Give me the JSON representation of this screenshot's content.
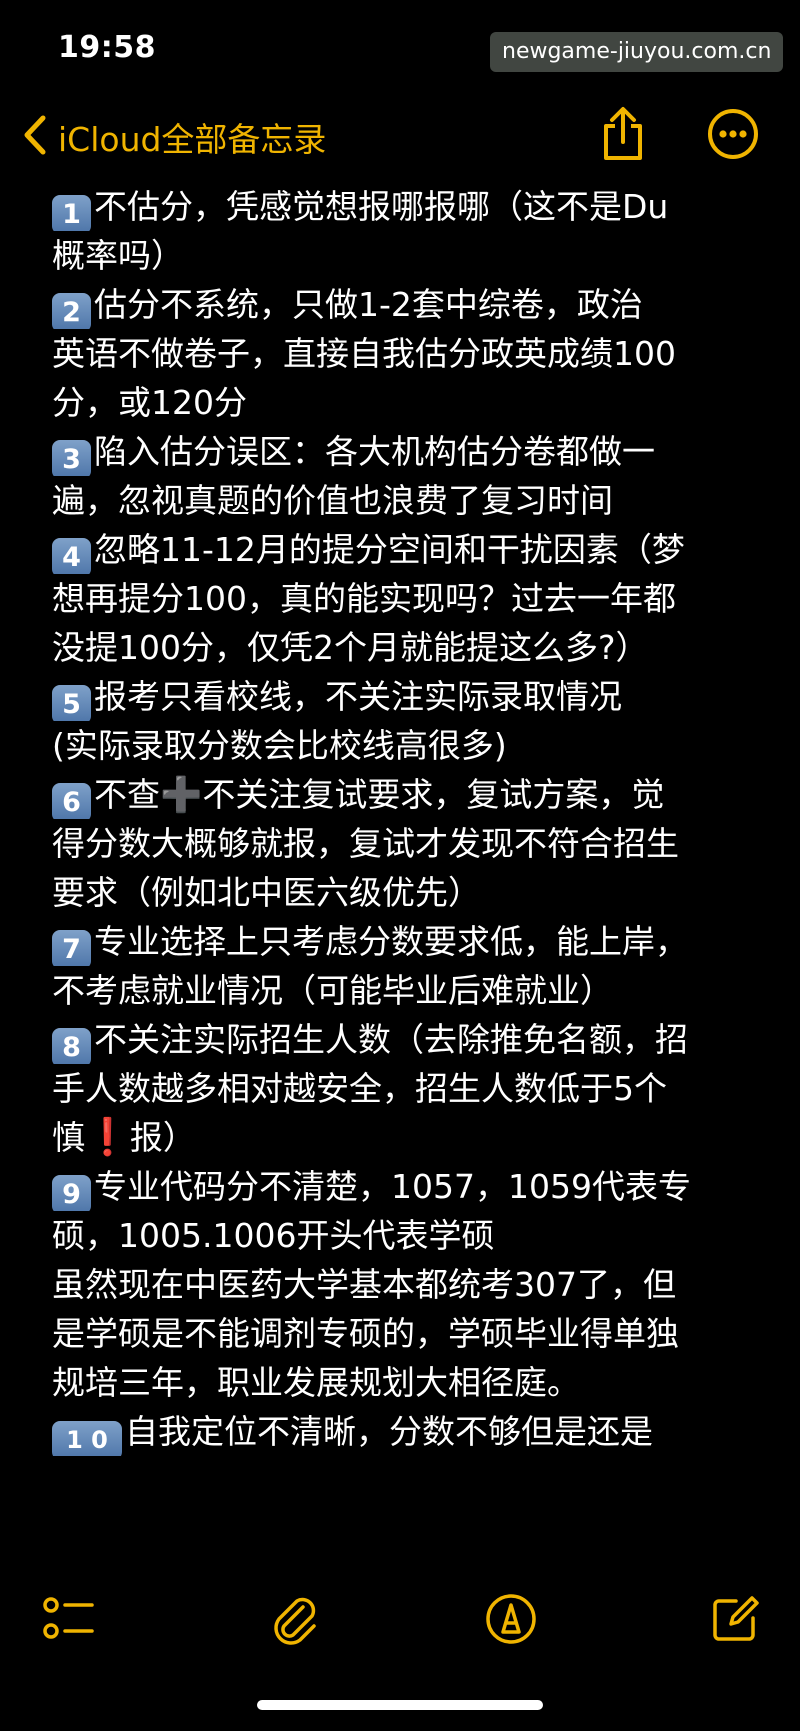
{
  "status_bar": {
    "time": "19:58",
    "watermark": "newgame-jiuyou.com.cn"
  },
  "nav": {
    "back_label": "iCloud全部备忘录",
    "accent_color": "#f0b400",
    "icons": [
      "chevron-left-icon",
      "share-icon",
      "more-icon"
    ]
  },
  "note": {
    "lines": [
      [
        "1",
        "不估分，凭感觉想报哪报哪（这不是Du"
      ],
      [
        "",
        "概率吗）"
      ],
      [
        "2",
        "估分不系统，只做1-2套中综卷，政治"
      ],
      [
        "",
        "英语不做卷子，直接自我估分政英成绩100"
      ],
      [
        "",
        "分，或120分"
      ],
      [
        "3",
        "陷入估分误区：各大机构估分卷都做一"
      ],
      [
        "",
        "遍，忽视真题的价值也浪费了复习时间"
      ],
      [
        "4",
        "忽略11-12月的提分空间和干扰因素（梦"
      ],
      [
        "",
        "想再提分100，真的能实现吗？过去一年都"
      ],
      [
        "",
        "没提100分，仅凭2个月就能提这么多?）"
      ],
      [
        "5",
        "报考只看校线，不关注实际录取情况"
      ],
      [
        "",
        "(实际录取分数会比校线高很多)"
      ],
      [
        "6",
        "不查",
        "➕",
        "不关注复试要求，复试方案，觉"
      ],
      [
        "",
        "得分数大概够就报，复试才发现不符合招生"
      ],
      [
        "",
        "要求（例如北中医六级优先）"
      ],
      [
        "7",
        "专业选择上只考虑分数要求低，能上岸，"
      ],
      [
        "",
        "不考虑就业情况（可能毕业后难就业）"
      ],
      [
        "8",
        "不关注实际招生人数（去除推免名额，招"
      ],
      [
        "",
        "手人数越多相对越安全，招生人数低于5个"
      ],
      [
        "",
        "慎",
        "❗",
        "报）"
      ],
      [
        "9",
        "专业代码分不清楚，1057，1059代表专"
      ],
      [
        "",
        "硕，1005.1006开头代表学硕"
      ],
      [
        "",
        "虽然现在中医药大学基本都统考307了，但"
      ],
      [
        "",
        "是学硕是不能调剂专硕的，学硕毕业得单独"
      ],
      [
        "",
        "规培三年，职业发展规划大相径庭。"
      ],
      [
        "1 0",
        "自我定位不清晰，分数不够但是还是"
      ]
    ]
  },
  "toolbar": {
    "icons": [
      "checklist-icon",
      "paperclip-icon",
      "markup-pen-icon",
      "compose-icon"
    ]
  }
}
